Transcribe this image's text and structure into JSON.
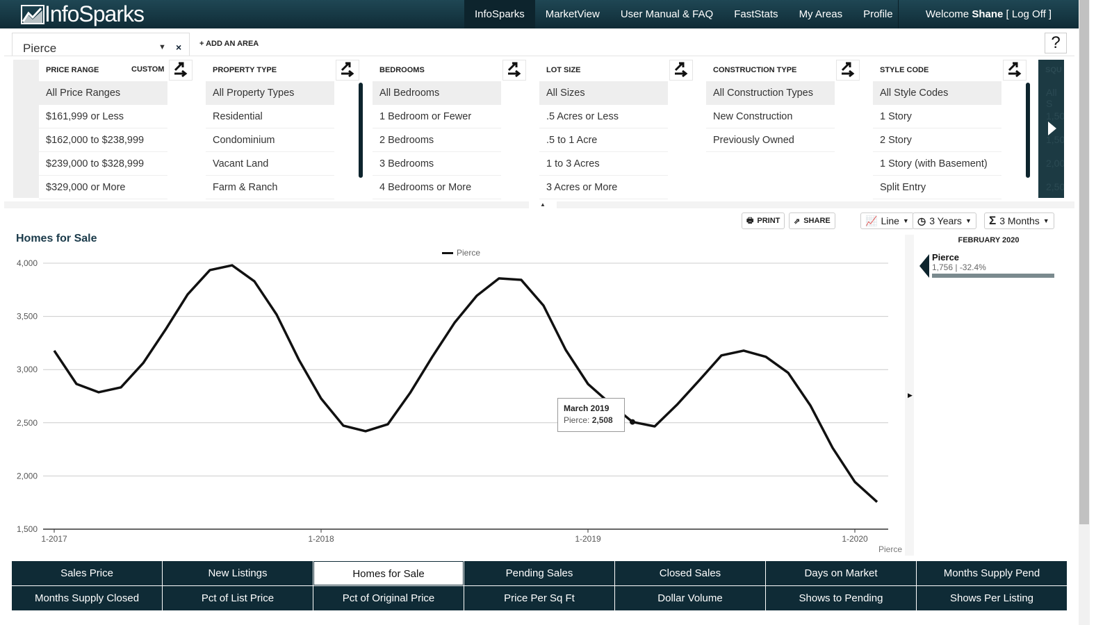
{
  "header": {
    "logo": "InfoSparks",
    "nav": [
      "InfoSparks",
      "MarketView",
      "User Manual & FAQ",
      "FastStats",
      "My Areas",
      "Profile"
    ],
    "active": "InfoSparks",
    "welcome_prefix": "Welcome ",
    "user": "Shane",
    "logoff": " [ Log Off ]"
  },
  "areas": {
    "current": "Pierce",
    "close": "×",
    "add_label": "+ ADD AN AREA",
    "help": "?"
  },
  "filters": [
    {
      "title": "PRICE RANGE",
      "custom": "CUSTOM",
      "items": [
        "All Price Ranges",
        "$161,999 or Less",
        "$162,000 to $238,999",
        "$239,000 to $328,999",
        "$329,000 or More"
      ]
    },
    {
      "title": "PROPERTY TYPE",
      "items": [
        "All Property Types",
        "Residential",
        "Condominium",
        "Vacant Land",
        "Farm & Ranch"
      ]
    },
    {
      "title": "BEDROOMS",
      "items": [
        "All Bedrooms",
        "1 Bedroom or Fewer",
        "2 Bedrooms",
        "3 Bedrooms",
        "4 Bedrooms or More"
      ]
    },
    {
      "title": "LOT SIZE",
      "items": [
        "All Sizes",
        ".5 Acres or Less",
        ".5 to 1 Acre",
        "1 to 3 Acres",
        "3 Acres or More"
      ]
    },
    {
      "title": "CONSTRUCTION TYPE",
      "items": [
        "All Construction Types",
        "New Construction",
        "Previously Owned"
      ]
    },
    {
      "title": "STYLE CODE",
      "items": [
        "All Style Codes",
        "1 Story",
        "2 Story",
        "1 Story (with Basement)",
        "Split Entry"
      ]
    }
  ],
  "hidden_filter": {
    "title": "SQU",
    "items": [
      "All S",
      "1,50",
      "1,50",
      "2,00",
      "2,50"
    ]
  },
  "toolbar": {
    "print": "PRINT",
    "share": "SHARE",
    "chart_type": "Line",
    "range": "3 Years",
    "rolling": "3 Months"
  },
  "chart_data": {
    "type": "line",
    "title": "Homes for Sale",
    "legend": [
      "Pierce"
    ],
    "x": [
      "1-2017",
      "2-2017",
      "3-2017",
      "4-2017",
      "5-2017",
      "6-2017",
      "7-2017",
      "8-2017",
      "9-2017",
      "10-2017",
      "11-2017",
      "12-2017",
      "1-2018",
      "2-2018",
      "3-2018",
      "4-2018",
      "5-2018",
      "6-2018",
      "7-2018",
      "8-2018",
      "9-2018",
      "10-2018",
      "11-2018",
      "12-2018",
      "1-2019",
      "2-2019",
      "3-2019",
      "4-2019",
      "5-2019",
      "6-2019",
      "7-2019",
      "8-2019",
      "9-2019",
      "10-2019",
      "11-2019",
      "12-2019",
      "1-2020",
      "2-2020"
    ],
    "series": [
      {
        "name": "Pierce",
        "values": [
          3178,
          2865,
          2787,
          2833,
          3061,
          3374,
          3707,
          3935,
          3980,
          3830,
          3517,
          3093,
          2728,
          2473,
          2421,
          2486,
          2780,
          3120,
          3440,
          3694,
          3857,
          3843,
          3602,
          3185,
          2865,
          2680,
          2508,
          2466,
          2669,
          2898,
          3133,
          3178,
          3120,
          2970,
          2663,
          2264,
          1944,
          1756
        ]
      }
    ],
    "xticks": [
      "1-2017",
      "1-2018",
      "1-2019",
      "1-2020"
    ],
    "yticks": [
      "4,000",
      "3,500",
      "3,000",
      "2,500",
      "2,000",
      "1,500"
    ],
    "ylim": [
      1500,
      4000
    ],
    "grid": true,
    "legend_position": "top-center",
    "source_label": "Pierce",
    "tooltip": {
      "title": "March 2019",
      "label": "Pierce:",
      "value": "2,508"
    },
    "color": "#111111"
  },
  "summary": {
    "date": "FEBRUARY 2020",
    "name": "Pierce",
    "value": "1,756 | -32.4%"
  },
  "metrics": [
    "Sales Price",
    "New Listings",
    "Homes for Sale",
    "Pending Sales",
    "Closed Sales",
    "Days on Market",
    "Months Supply Pend",
    "Months Supply Closed",
    "Pct of List Price",
    "Pct of Original Price",
    "Price Per Sq Ft",
    "Dollar Volume",
    "Shows to Pending",
    "Shows Per Listing"
  ],
  "active_metric": "Homes for Sale"
}
